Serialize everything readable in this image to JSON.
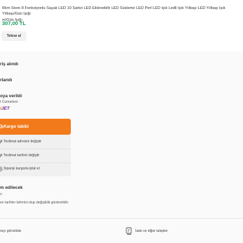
{
  "product": {
    "title": "Rkm Store 8 Fonksiyonlu Saçak LED 10 Sarkıt LED Eklenebilir LED Süsleme LED Perl LED Işık Ledli Işık Yılbaşı LED Yılbaşı Işık Yılbaşı/Gün Işığı",
    "title_cont": "m/Gün Işığı",
    "price": "307,00 TL",
    "reorder_label": "Tekrar al"
  },
  "timeline": {
    "received": "riş alındı",
    "prepared": "rlandı",
    "shipped": "oya verildi",
    "shipped_date": "t Cumartesi",
    "carrier_part1": "i",
    "carrier_part2": "JET",
    "to_deliver": "m edilecek",
    "to_deliver_sub": "n"
  },
  "menu": {
    "active_label": "Kargo takibi",
    "items": [
      {
        "label": "Teslimat adresini değiştir"
      },
      {
        "label": "Teslimat tarihini değiştir"
      },
      {
        "label": "Siparişi kargoda iptal et"
      }
    ]
  },
  "note": "en tarihler tahmini olup değişiklik gösterebilir.",
  "footer": {
    "left_label": "rayı görüntüle",
    "right_label": "İade ve diğer talepler"
  },
  "colors": {
    "accent": "#f27a1a",
    "price": "#0f9d58",
    "carrier_purple": "#6a2c8f"
  },
  "icons": [
    "truck-icon",
    "pencil-icon",
    "cancel-icon",
    "return-request-icon"
  ]
}
